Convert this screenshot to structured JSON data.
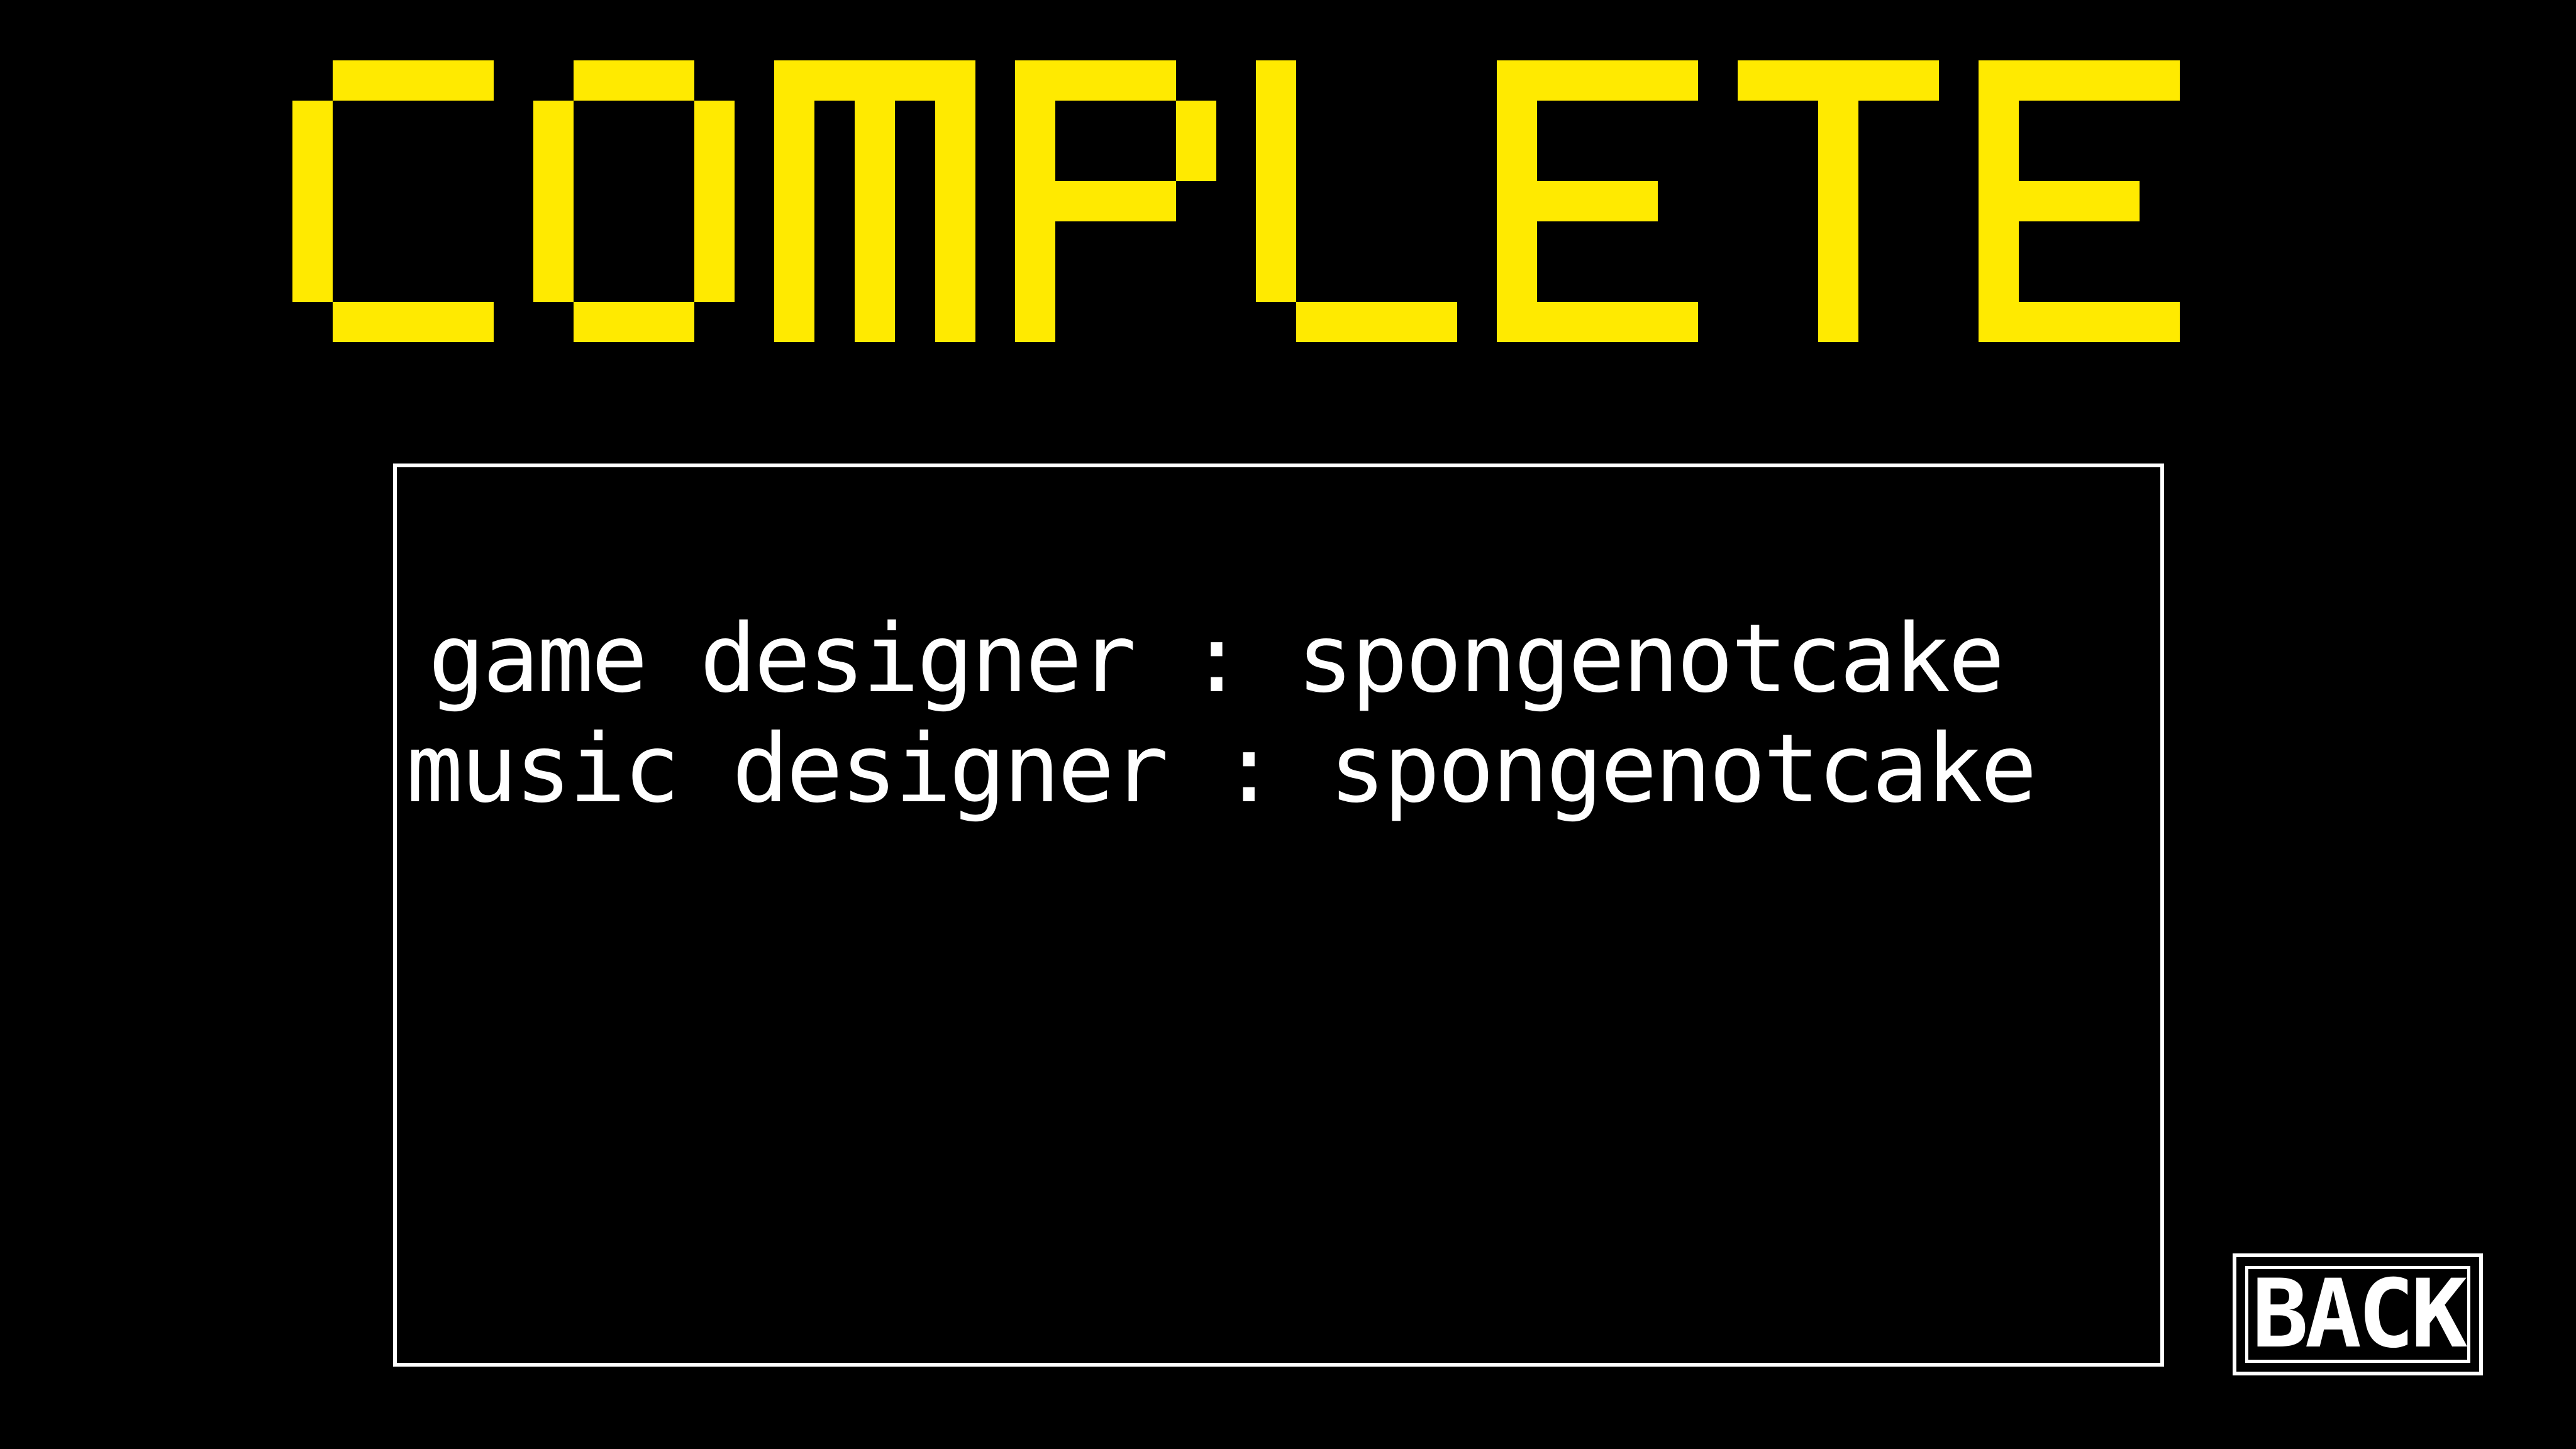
{
  "title": {
    "text": "COMPLETE",
    "color": "#ffea00"
  },
  "credits": {
    "lines": [
      {
        "role": "game designer",
        "name": "spongenotcake"
      },
      {
        "role": "music designer",
        "name": "spongenotcake"
      }
    ],
    "line_texts": [
      "game designer : spongenotcake",
      "music designer : spongenotcake"
    ],
    "border_color": "#ffffff"
  },
  "back_button": {
    "label": "BACK"
  },
  "colors": {
    "background": "#000000",
    "text": "#ffffff",
    "accent": "#ffea00"
  }
}
